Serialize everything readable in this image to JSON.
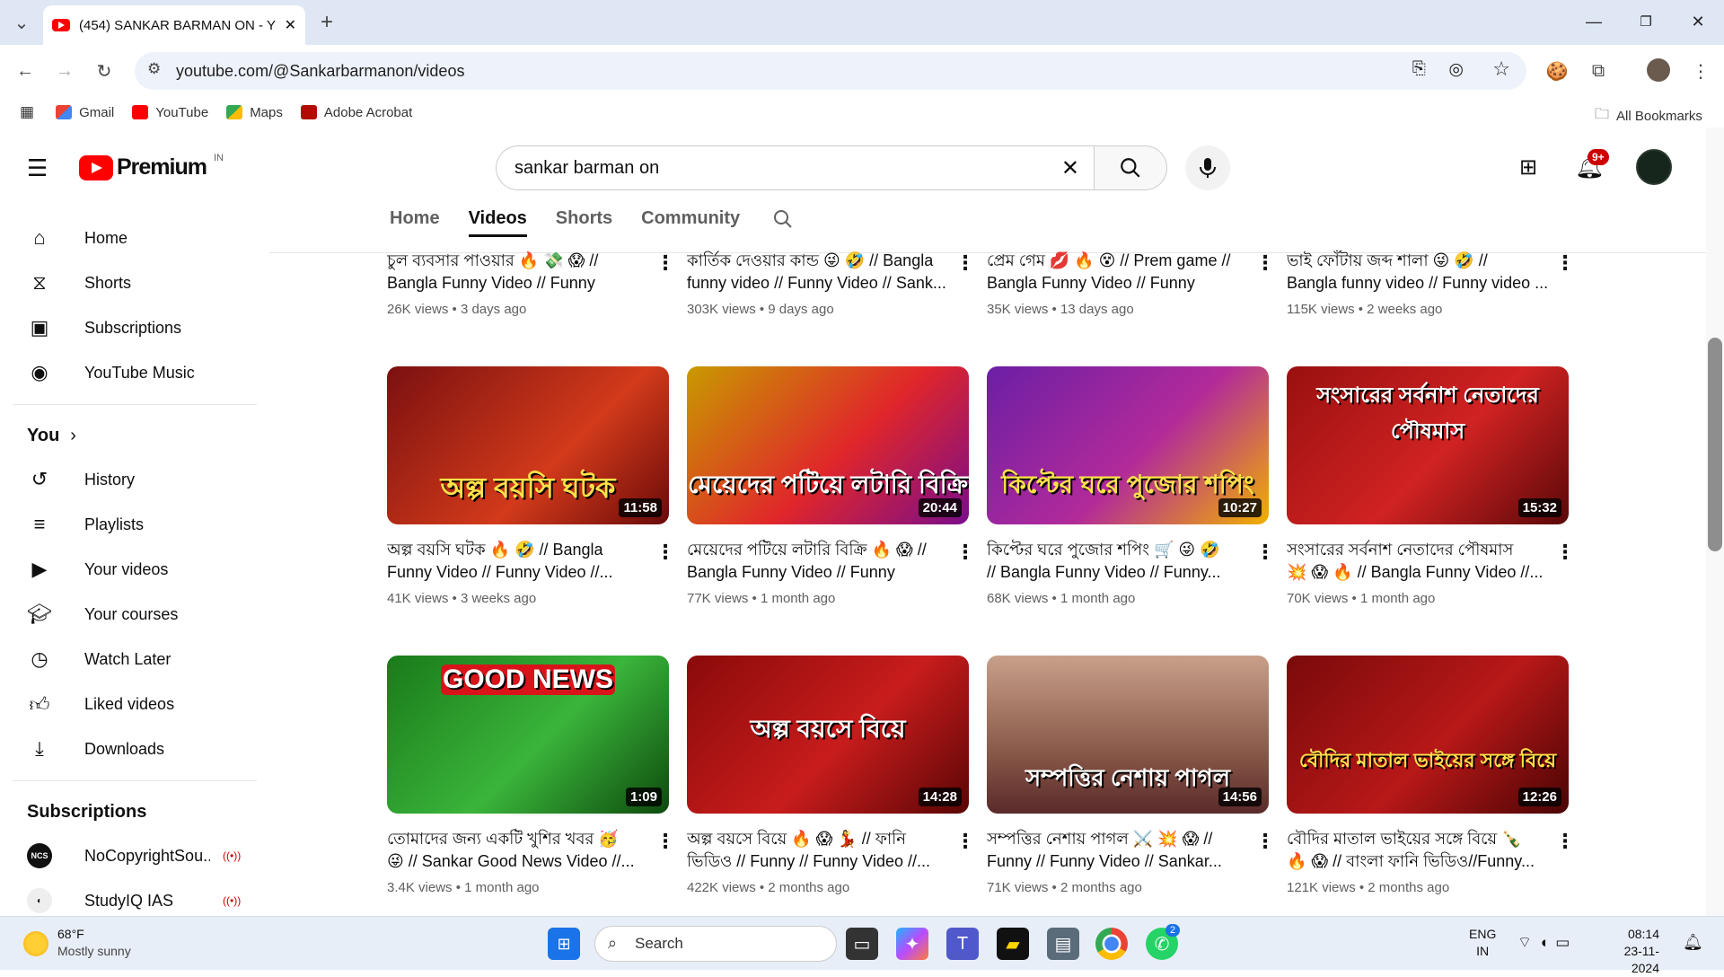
{
  "browser": {
    "tab_title": "(454) SANKAR BARMAN ON - Y",
    "url": "youtube.com/@Sankarbarmanon/videos",
    "bookmarks": [
      "Gmail",
      "YouTube",
      "Maps",
      "Adobe Acrobat"
    ],
    "all_bookmarks": "All Bookmarks"
  },
  "yt": {
    "logo_text": "Premium",
    "region": "IN",
    "search_value": "sankar barman on",
    "notif_count": "9+"
  },
  "channel_tabs": [
    "Home",
    "Videos",
    "Shorts",
    "Community"
  ],
  "sidebar": {
    "main": [
      "Home",
      "Shorts",
      "Subscriptions",
      "YouTube Music"
    ],
    "you_header": "You",
    "you": [
      "History",
      "Playlists",
      "Your videos",
      "Your courses",
      "Watch Later",
      "Liked videos",
      "Downloads"
    ],
    "subs_header": "Subscriptions",
    "subs": [
      "NoCopyrightSou...",
      "StudyIQ IAS"
    ]
  },
  "videos_top": [
    {
      "t1": "চুল ব্যবসার পাওয়ার 🔥 💸 😱 //",
      "t2": "Bangla Funny Video // Funny Video...",
      "meta": "26K views • 3 days ago"
    },
    {
      "t1": "কার্তিক দেওয়ার কান্ড 😜 🤣 // Bangla",
      "t2": "funny video // Funny Video // Sank...",
      "meta": "303K views • 9 days ago"
    },
    {
      "t1": "প্রেম গেম 💋 🔥 😵 // Prem game //",
      "t2": "Bangla Funny Video // Funny Video...",
      "meta": "35K views • 13 days ago"
    },
    {
      "t1": "ভাই ফোঁটায় জব্দ শালা 😜 🤣 //",
      "t2": "Bangla funny video // Funny video ...",
      "meta": "115K views • 2 weeks ago"
    }
  ],
  "videos_row2": [
    {
      "thumb": "অল্প বয়সি ঘটক",
      "dur": "11:58",
      "t1": "অল্প বয়সি ঘটক 🔥 🤣 // Bangla",
      "t2": "Funny Video // Funny Video //...",
      "meta": "41K views • 3 weeks ago"
    },
    {
      "thumb": "মেয়েদের পটিয়ে লটারি বিক্রি",
      "dur": "20:44",
      "t1": "মেয়েদের পটিয়ে লটারি বিক্রি 🔥 😱 //",
      "t2": "Bangla Funny Video // Funny Video...",
      "meta": "77K views • 1 month ago"
    },
    {
      "thumb": "কিপ্টের ঘরে পুজোর শপিং",
      "dur": "10:27",
      "t1": "কিপ্টের ঘরে পুজোর শপিং 🛒 😜 🤣",
      "t2": "// Bangla Funny Video // Funny...",
      "meta": "68K views • 1 month ago"
    },
    {
      "thumb": "সংসারের সর্বনাশ নেতাদের পৌষমাস",
      "dur": "15:32",
      "t1": "সংসারের সর্বনাশ নেতাদের পৌষমাস",
      "t2": "💥 😱 🔥 // Bangla Funny Video //...",
      "meta": "70K views • 1 month ago"
    }
  ],
  "videos_row3": [
    {
      "thumb": "GOOD NEWS",
      "dur": "1:09",
      "t1": "তোমাদের জন্য একটি খুশির খবর 🥳",
      "t2": "😜 // Sankar Good News Video //...",
      "meta": "3.4K views • 1 month ago"
    },
    {
      "thumb": "অল্প বয়সে বিয়ে",
      "dur": "14:28",
      "t1": "অল্প বয়সে বিয়ে 🔥 😱 💃 // ফানি",
      "t2": "ভিডিও // Funny // Funny Video //...",
      "meta": "422K views • 2 months ago"
    },
    {
      "thumb": "সম্পত্তির নেশায় পাগল",
      "dur": "14:56",
      "t1": "সম্পত্তির নেশায় পাগল ⚔️ 💥 😱 //",
      "t2": "Funny // Funny Video // Sankar...",
      "meta": "71K views • 2 months ago"
    },
    {
      "thumb": "বৌদির মাতাল ভাইয়ের সঙ্গে বিয়ে",
      "dur": "12:26",
      "t1": "বৌদির মাতাল ভাইয়ের সঙ্গে বিয়ে 🍾",
      "t2": "🔥 😱 // বাংলা ফানি ভিডিও//Funny...",
      "meta": "121K views • 2 months ago"
    }
  ],
  "taskbar": {
    "temp": "68°F",
    "weather": "Mostly sunny",
    "search": "Search",
    "lang1": "ENG",
    "lang2": "IN",
    "time": "08:14",
    "date": "23-11-2024",
    "whatsapp_badge": "2"
  },
  "colors": {
    "yt_red": "#ff0000",
    "accent": "#0f0f0f"
  }
}
